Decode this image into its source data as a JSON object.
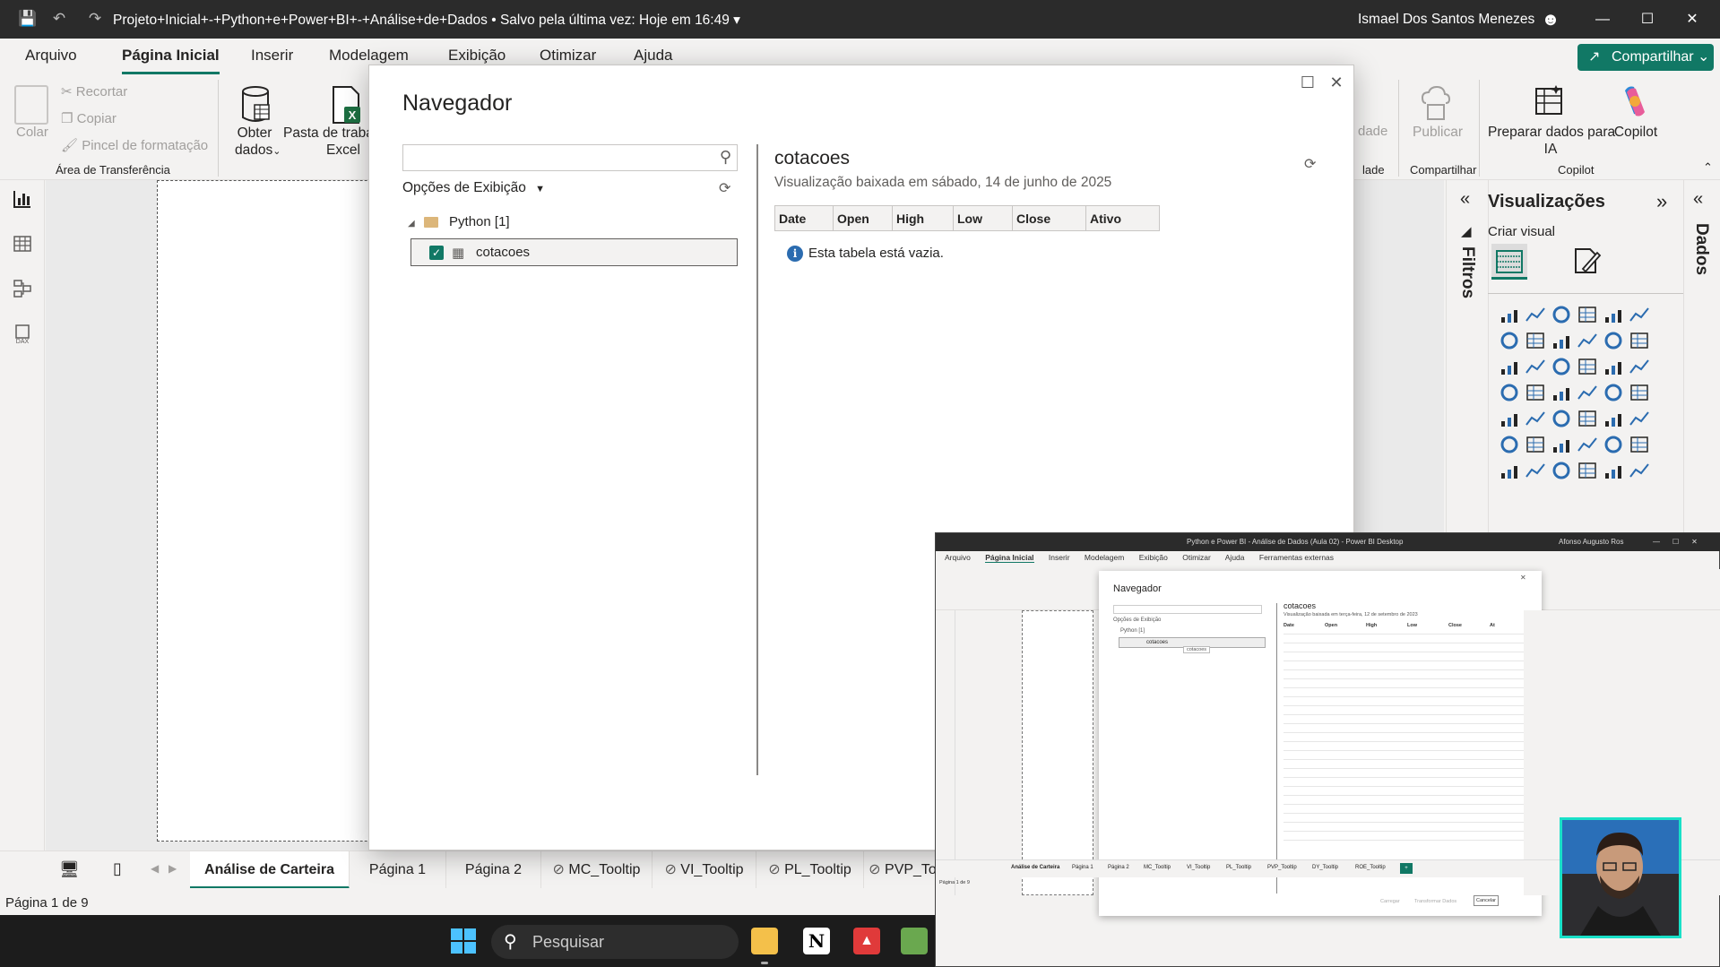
{
  "window": {
    "doc_title": "Projeto+Inicial+-+Python+e+Power+BI+-+Análise+de+Dados",
    "saved_status": "• Salvo pela última vez: Hoje em 16:49",
    "user": "Ismael Dos Santos Menezes"
  },
  "menu": {
    "items": [
      "Arquivo",
      "Página Inicial",
      "Inserir",
      "Modelagem",
      "Exibição",
      "Otimizar",
      "Ajuda"
    ],
    "active": "Página Inicial",
    "share": "Compartilhar"
  },
  "ribbon": {
    "paste": "Colar",
    "cut": "Recortar",
    "copy": "Copiar",
    "format_painter": "Pincel de formatação",
    "clipboard_group": "Área de Transferência",
    "get_data_1": "Obter",
    "get_data_2": "dados",
    "excel_1": "Pasta de traba",
    "excel_2": "Excel",
    "cut_off_1": "dade",
    "cut_off_2": "lade",
    "publish": "Publicar",
    "share_group": "Compartilhar",
    "prepare_data_1": "Preparar dados para",
    "prepare_data_2": "IA",
    "copilot": "Copilot",
    "copilot_group": "Copilot"
  },
  "navigator": {
    "title": "Navegador",
    "search_placeholder": "",
    "display_options": "Opções de Exibição",
    "folder": "Python [1]",
    "item": "cotacoes",
    "preview_title": "cotacoes",
    "preview_subtitle": "Visualização baixada em sábado, 14 de junho de 2025",
    "columns": [
      "Date",
      "Open",
      "High",
      "Low",
      "Close",
      "Ativo"
    ],
    "empty_message": "Esta tabela está vazia."
  },
  "panes": {
    "filters": "Filtros",
    "visualizations": "Visualizações",
    "build_visual": "Criar visual",
    "data": "Dados"
  },
  "pages": {
    "tabs": [
      "Análise de Carteira",
      "Página 1",
      "Página 2",
      "MC_Tooltip",
      "VI_Tooltip",
      "PL_Tooltip",
      "PVP_To"
    ],
    "active": "Análise de Carteira",
    "page_count": "Página 1 de 9"
  },
  "taskbar": {
    "search": "Pesquisar"
  },
  "video": {
    "title": "Python e Power BI - Análise de Dados (Aula 02) - Power BI Desktop",
    "user": "Afonso Augusto Ros",
    "menu": [
      "Arquivo",
      "Página Inicial",
      "Inserir",
      "Modelagem",
      "Exibição",
      "Otimizar",
      "Ajuda",
      "Ferramentas externas"
    ],
    "nav_title": "Navegador",
    "nav_folder": "Python [1]",
    "nav_item": "cotacoes",
    "nav_options": "Opções de Exibição",
    "preview_title": "cotacoes",
    "preview_sub": "Visualização baixada em terça-feira, 12 de setembro de 2023",
    "columns": [
      "Date",
      "Open",
      "High",
      "Low",
      "Close",
      "At"
    ],
    "btn_load": "Carregar",
    "btn_transform": "Transformar Dados",
    "btn_cancel": "Cancelar",
    "tabs": [
      "Análise de Carteira",
      "Página 1",
      "Página 2",
      "MC_Tooltip",
      "VI_Tooltip",
      "PL_Tooltip",
      "PVP_Tooltip",
      "DY_Tooltip",
      "ROE_Tooltip"
    ],
    "page_count": "Página 1 de 9"
  }
}
